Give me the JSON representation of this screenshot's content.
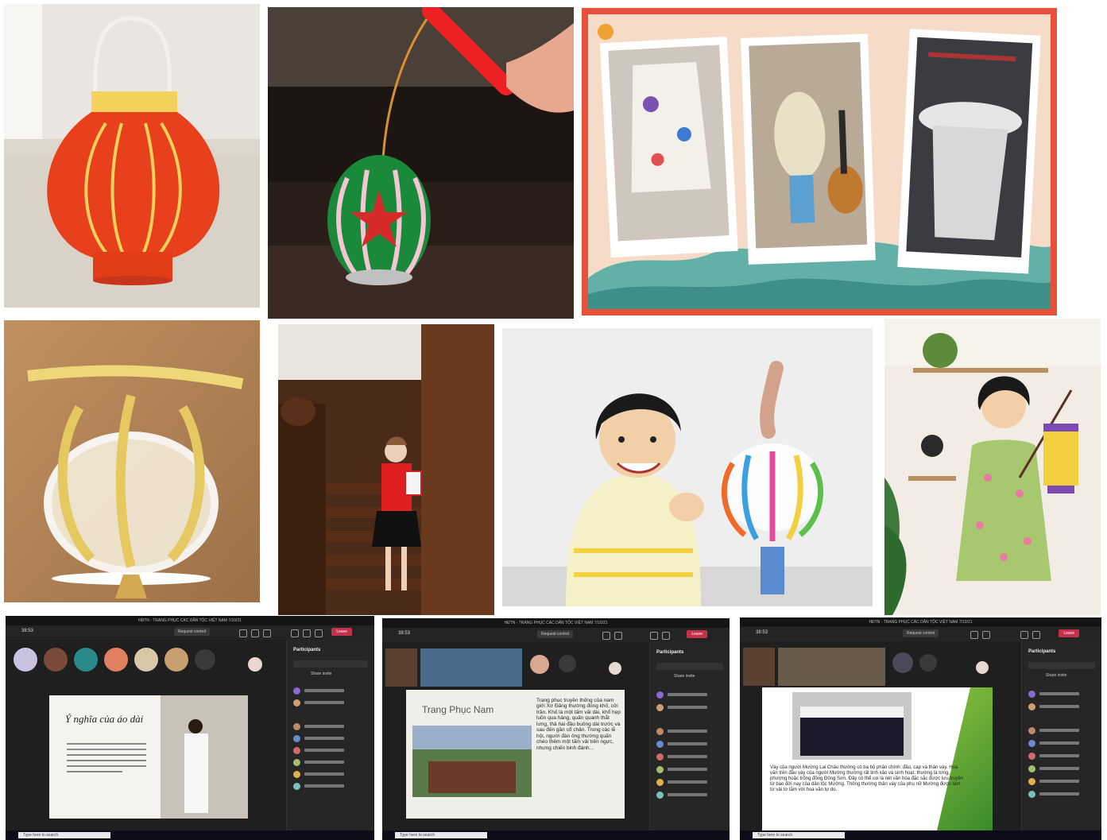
{
  "collage": {
    "tiles": [
      {
        "name": "photo-red-paper-lantern"
      },
      {
        "name": "photo-soda-can-lantern"
      },
      {
        "name": "photo-decorated-paper-lanterns-collage"
      },
      {
        "name": "photo-yellow-paper-lantern"
      },
      {
        "name": "photo-girl-on-stairs-with-lantern"
      },
      {
        "name": "photo-girl-with-colorful-lantern"
      },
      {
        "name": "photo-girl-in-floral-dress-with-lantern"
      }
    ]
  },
  "teams": [
    {
      "window_title": "HĐTN - TRANG PHỤC CÁC DÂN TỘC VIỆT NAM 7/10/21",
      "timer": "38:53",
      "request_control": "Request control",
      "leave": "Leave",
      "panel_title": "Participants",
      "share_invite": "Share invite",
      "slide_title": "Ý nghĩa của áo dài",
      "search_placeholder": "Type here to search"
    },
    {
      "window_title": "HĐTN - TRANG PHỤC CÁC DÂN TỘC VIỆT NAM 7/10/21",
      "timer": "38:53",
      "request_control": "Request control",
      "leave": "Leave",
      "panel_title": "Participants",
      "share_invite": "Share invite",
      "slide_title": "Trang Phục Nam",
      "slide_bullet": "Trang phục truyền thống của nam giới Xơ Đăng thường đóng khố, cởi trần. Khố là một tấm vải dài, khổ hẹp luồn qua háng, quấn quanh thắt lưng, thả hai đầu buông dài trước và sau đến gần cổ chân. Trong các lễ hội, người đàn ông thường quấn chéo thêm một tấm vải trên ngực, nhưng chiến binh đánh...",
      "search_placeholder": "Type here to search"
    },
    {
      "window_title": "HĐTN - TRANG PHỤC CÁC DÂN TỘC VIỆT NAM 7/10/21",
      "timer": "38:53",
      "request_control": "Request control",
      "leave": "Leave",
      "panel_title": "Participants",
      "share_invite": "Share invite",
      "slide_text": "Váy của người Mường Lai Châu thường có ba bộ phận chính: đầu, cạp và thân váy. Hoa văn trên đầu váy của người Mường thường rất tinh xảo và sinh hoạt, thường là lưng, phượng hoặc trống đồng Đông Sơn. Đây có thể coi là nét văn hóa đặc sắc được lưu truyền từ bao đời nay của dân tộc Mường. Thông thường thân váy của phụ nữ Mường được làm từ vải tơ tằm với hoa văn tự do.",
      "search_placeholder": "Type here to search"
    }
  ],
  "colors": {
    "lantern_red": "#e8401c",
    "lantern_yellow": "#f2d25a",
    "pastel_bg": "#f6dcc8",
    "frame_red": "#e8503a",
    "teams_dark": "#1f1f1f",
    "leave_red": "#c4314b"
  }
}
